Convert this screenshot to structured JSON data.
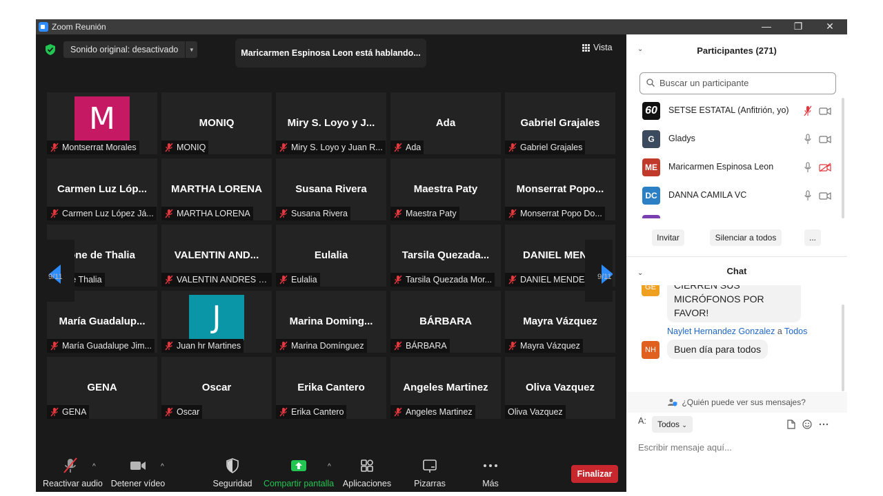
{
  "window": {
    "title": "Zoom Reunión",
    "controls": [
      "—",
      "❐",
      "✕"
    ]
  },
  "top_bar": {
    "audio_setting": "Sonido original: desactivado",
    "speaking_banner": "Maricarmen Espinosa Leon está hablando...",
    "view_label": "Vista"
  },
  "gallery": {
    "page_indicator": "9/11",
    "tiles": [
      {
        "display": "M",
        "label": "Montserrat Morales",
        "muted": true,
        "avatar_color": "#c51a63"
      },
      {
        "display": "MONIQ",
        "label": "MONIQ",
        "muted": true
      },
      {
        "display": "Miry S. Loyo y J...",
        "label": "Miry S. Loyo y Juan R...",
        "muted": true
      },
      {
        "display": "Ada",
        "label": "Ada",
        "muted": true
      },
      {
        "display": "Gabriel Grajales",
        "label": "Gabriel Grajales",
        "muted": true
      },
      {
        "display": "Carmen Luz Lóp...",
        "label": "Carmen Luz López Já...",
        "muted": true
      },
      {
        "display": "MARTHA LORENA",
        "label": "MARTHA LORENA",
        "muted": true
      },
      {
        "display": "Susana Rivera",
        "label": "Susana Rivera",
        "muted": true
      },
      {
        "display": "Maestra Paty",
        "label": "Maestra Paty",
        "muted": true
      },
      {
        "display": "Monserrat  Popo...",
        "label": "Monserrat Popo Do...",
        "muted": true
      },
      {
        "display": "one de Thalia",
        "label": "one de Thalia",
        "muted": false
      },
      {
        "display": "VALENTIN AND...",
        "label": "VALENTIN ANDRES G...",
        "muted": true
      },
      {
        "display": "Eulalia",
        "label": "Eulalia",
        "muted": true
      },
      {
        "display": "Tarsila  Quezada...",
        "label": "Tarsila Quezada Mor...",
        "muted": true
      },
      {
        "display": "DANIEL MENDI",
        "label": "DANIEL MENDEZ",
        "muted": true
      },
      {
        "display": "María  Guadalup...",
        "label": "María Guadalupe Jim...",
        "muted": true
      },
      {
        "display": "J",
        "label": "Juan hr Martines",
        "muted": true,
        "avatar_color": "#0a96a6"
      },
      {
        "display": "Marina  Doming...",
        "label": "Marina Domínguez",
        "muted": true
      },
      {
        "display": "BÁRBARA",
        "label": "BÁRBARA",
        "muted": true
      },
      {
        "display": "Mayra Vázquez",
        "label": "Mayra Vázquez",
        "muted": true
      },
      {
        "display": "GENA",
        "label": "GENA",
        "muted": true
      },
      {
        "display": "Oscar",
        "label": "Oscar",
        "muted": true
      },
      {
        "display": "Erika Cantero",
        "label": "Erika Cantero",
        "muted": true
      },
      {
        "display": "Angeles Martinez",
        "label": "Angeles Martinez",
        "muted": true
      },
      {
        "display": "Oliva Vazquez",
        "label": "Oliva Vazquez",
        "muted": false
      }
    ]
  },
  "toolbar": {
    "unmute": "Reactivar audio",
    "stop_video": "Detener vídeo",
    "security": "Seguridad",
    "share": "Compartir pantalla",
    "apps": "Aplicaciones",
    "whiteboards": "Pizarras",
    "more": "Más",
    "end": "Finalizar"
  },
  "participants": {
    "title": "Participantes (271)",
    "search_placeholder": "Buscar un participante",
    "list": [
      {
        "initials": "60",
        "name": "SETSE ESTATAL (Anfitrión, yo)",
        "color": "#111111",
        "mic_muted": true,
        "video_off": false
      },
      {
        "initials": "G",
        "name": "Gladys",
        "color": "#3b4a5c",
        "mic_muted": false,
        "video_off": false
      },
      {
        "initials": "ME",
        "name": "Maricarmen Espinosa Leon",
        "color": "#c0392b",
        "mic_muted": false,
        "video_off": true
      },
      {
        "initials": "DC",
        "name": "DANNA CAMILA VC",
        "color": "#2b7fc4",
        "mic_muted": false,
        "video_off": false
      }
    ],
    "invite": "Invitar",
    "mute_all": "Silenciar a todos",
    "more": "..."
  },
  "chat": {
    "title": "Chat",
    "messages": [
      {
        "initials": "GE",
        "color": "#f0a020",
        "text_lines": [
          "CIERREN SUS",
          "MICRÓFONOS POR FAVOR!"
        ]
      },
      {
        "initials": "NH",
        "color": "#e0611f",
        "sender": "Naylet Hernandez Gonzalez",
        "to_word": "a",
        "to": "Todos",
        "text": "Buen día para todos"
      }
    ],
    "who_sees": "¿Quién puede ver sus mensajes?",
    "to_label": "A:",
    "to_value": "Todos",
    "compose_placeholder": "Escribir mensaje aquí..."
  }
}
